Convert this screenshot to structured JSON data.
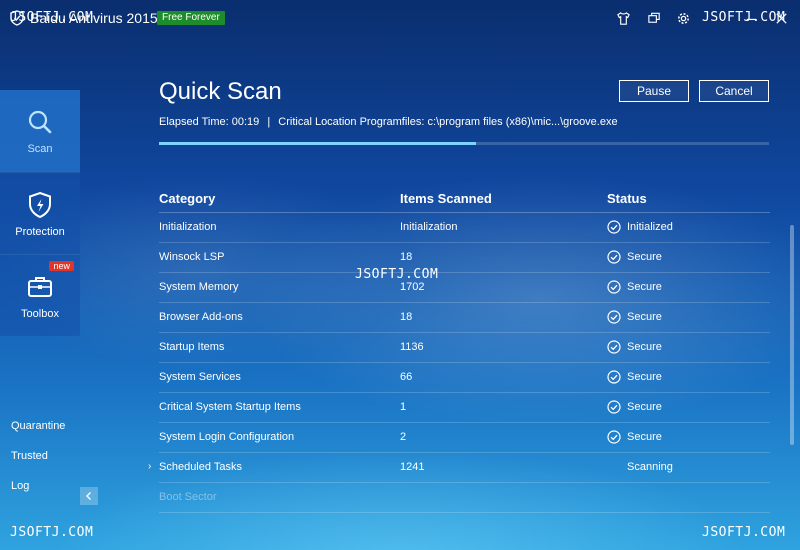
{
  "titlebar": {
    "title": "Baidu Antivirus 2015",
    "badge": "Free Forever",
    "watermark": "JSOFTJ.COM",
    "icons": [
      "shirt-icon",
      "restore-icon",
      "gear-icon",
      "minimize-icon",
      "close-icon"
    ]
  },
  "sidebar": {
    "items": [
      {
        "label": "Scan",
        "icon": "search-icon"
      },
      {
        "label": "Protection",
        "icon": "shield-icon"
      },
      {
        "label": "Toolbox",
        "icon": "toolbox-icon",
        "badge": "new"
      }
    ],
    "links": [
      "Quarantine",
      "Trusted",
      "Log"
    ]
  },
  "main": {
    "title": "Quick Scan",
    "pause_label": "Pause",
    "cancel_label": "Cancel",
    "elapsed_label": "Elapsed Time:",
    "elapsed_value": "00:19",
    "separator": "|",
    "location_label": "Critical Location Programfiles:",
    "location_value": "c:\\program files (x86)\\mic...\\groove.exe",
    "progress_fraction": 0.52
  },
  "table": {
    "headers": [
      "Category",
      "Items Scanned",
      "Status"
    ],
    "rows": [
      {
        "category": "Initialization",
        "items": "Initialization",
        "status": "Initialized",
        "check": true
      },
      {
        "category": "Winsock LSP",
        "items": "18",
        "status": "Secure",
        "check": true
      },
      {
        "category": "System Memory",
        "items": "1702",
        "status": "Secure",
        "check": true
      },
      {
        "category": "Browser Add-ons",
        "items": "18",
        "status": "Secure",
        "check": true
      },
      {
        "category": "Startup Items",
        "items": "1136",
        "status": "Secure",
        "check": true
      },
      {
        "category": "System Services",
        "items": "66",
        "status": "Secure",
        "check": true
      },
      {
        "category": "Critical System Startup Items",
        "items": "1",
        "status": "Secure",
        "check": true
      },
      {
        "category": "System Login Configuration",
        "items": "2",
        "status": "Secure",
        "check": true
      },
      {
        "category": "Scheduled Tasks",
        "items": "1241",
        "status": "Scanning",
        "check": false,
        "current": true
      },
      {
        "category": "Boot Sector",
        "items": "",
        "status": "",
        "check": false,
        "dim": true
      }
    ]
  },
  "colors": {
    "badge_green": "#1e8c2a",
    "new_red": "#e2352a",
    "progress": "#7fd3ff",
    "nav_active": "#2270c8"
  }
}
